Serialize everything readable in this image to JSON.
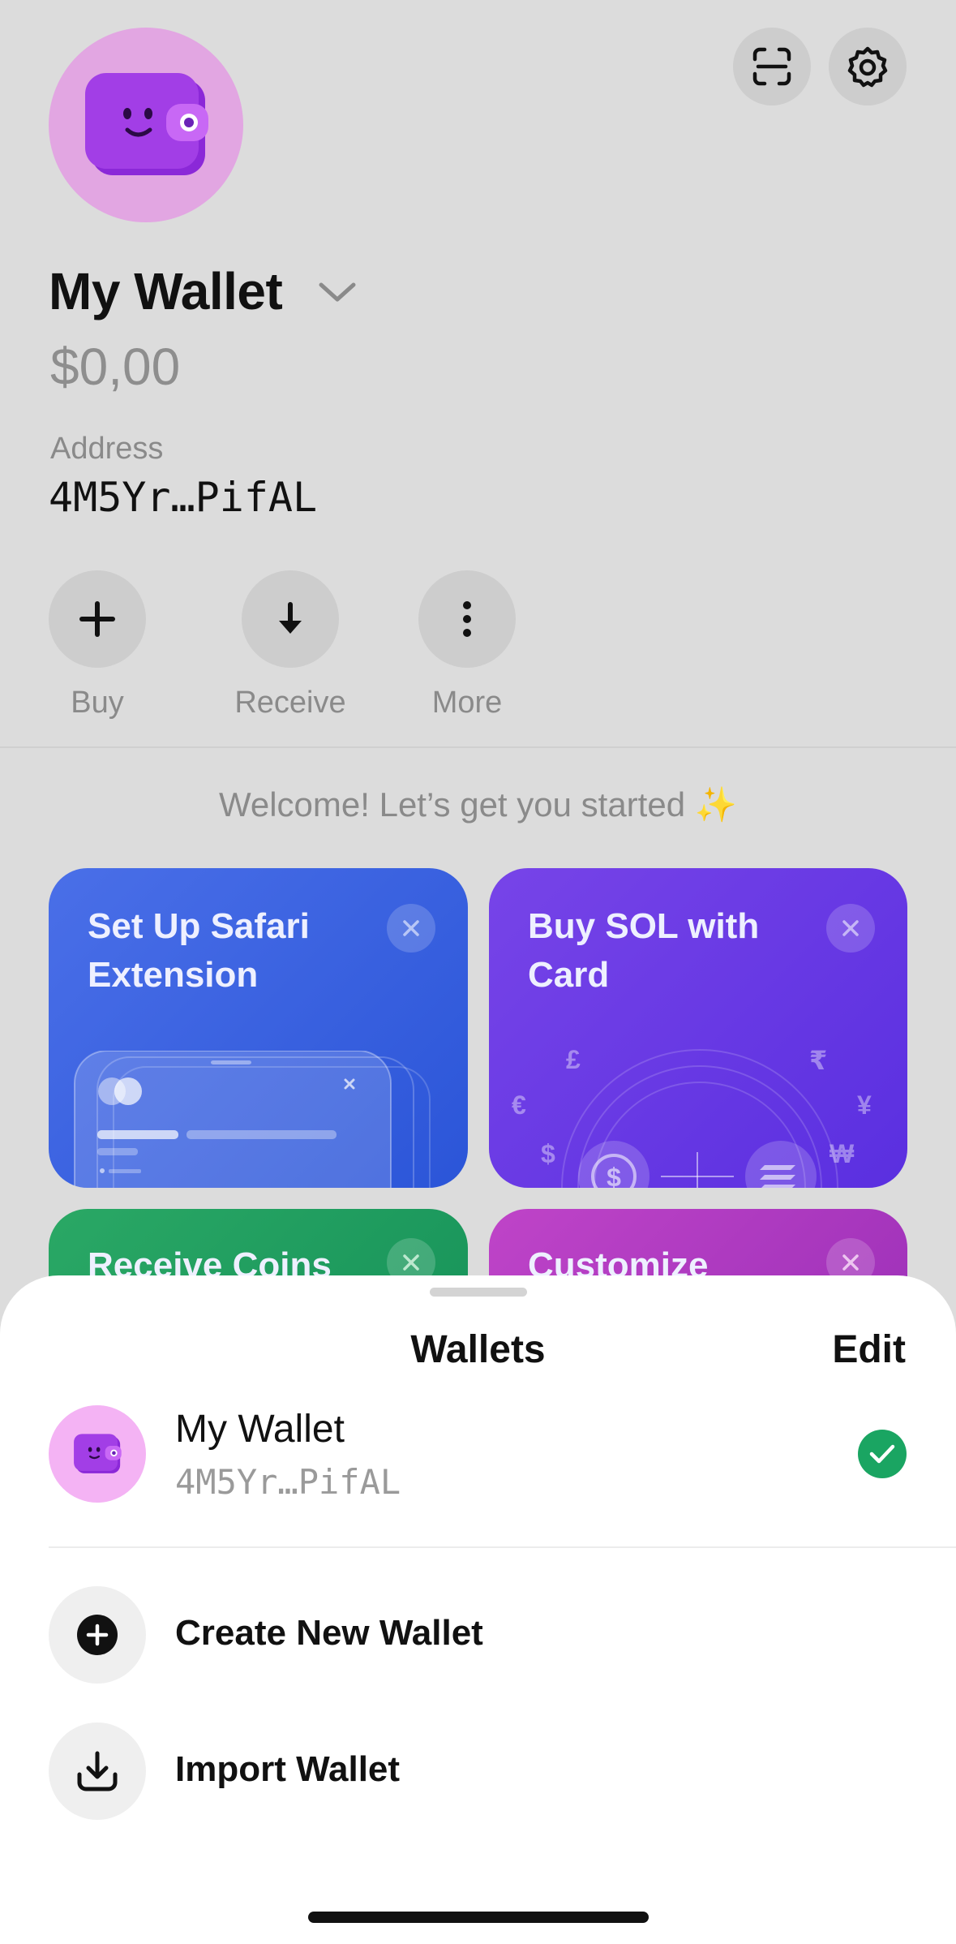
{
  "header": {
    "scan_icon": "scan-icon",
    "settings_icon": "gear-icon",
    "wallet_name": "My Wallet",
    "balance": "$0,00",
    "address_label": "Address",
    "address_value": "4M5Yr…PifAL"
  },
  "actions": [
    {
      "label": "Buy",
      "icon": "plus-icon"
    },
    {
      "label": "Receive",
      "icon": "download-arrow-icon"
    },
    {
      "label": "More",
      "icon": "more-vertical-icon"
    }
  ],
  "welcome": "Welcome! Let’s get you started ✨",
  "cards": [
    {
      "title": "Set Up Safari Extension",
      "color": "#3d63e2"
    },
    {
      "title": "Buy SOL with Card",
      "color": "#6e3ce6"
    },
    {
      "title": "Receive Coins",
      "color": "#22a05e"
    },
    {
      "title": "Customize",
      "color": "#b43cc0"
    }
  ],
  "card_art": {
    "currency_symbols": [
      "£",
      "₹",
      "€",
      "¥",
      "$",
      "₩"
    ]
  },
  "sheet": {
    "title": "Wallets",
    "edit_label": "Edit",
    "wallet": {
      "name": "My Wallet",
      "address": "4M5Yr…PifAL",
      "selected": true
    },
    "menu": [
      {
        "label": "Create New Wallet",
        "icon": "plus-circle-icon"
      },
      {
        "label": "Import Wallet",
        "icon": "import-icon"
      }
    ]
  },
  "colors": {
    "avatar_bg": "#e2a6e2",
    "wallet_purple": "#a23ee6",
    "check_green": "#1aa562"
  }
}
